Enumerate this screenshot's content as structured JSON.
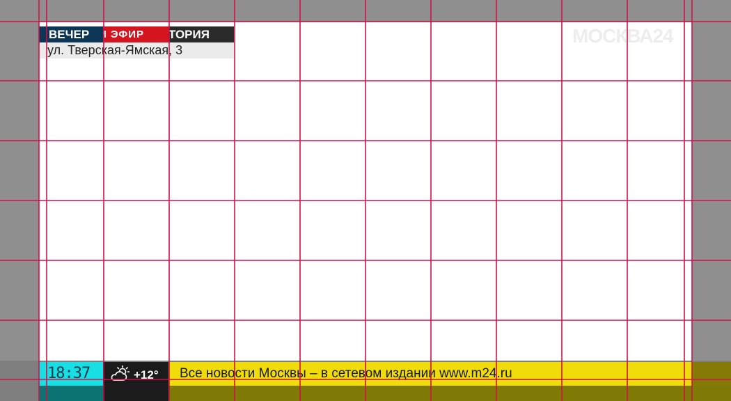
{
  "program_plate": {
    "segment_left": "ВЕЧЕР",
    "segment_live": "И ЭФИР",
    "segment_right": "ТОРИЯ",
    "location": "ул. Тверская-Ямская, 3"
  },
  "channel_logo": "МОСКВА24",
  "clock": {
    "time": "18:37"
  },
  "weather": {
    "icon": "partly-cloudy-icon",
    "temperature": "+12°"
  },
  "ticker": {
    "text": "Все новости Москвы – в сетевом издании www.m24.ru"
  },
  "colors": {
    "plate_blue": "#0d3556",
    "plate_red": "#d4151f",
    "clock_cyan": "#17dfe4",
    "ticker_yellow": "#f0dc0b",
    "grid_line": "#d0104a"
  }
}
